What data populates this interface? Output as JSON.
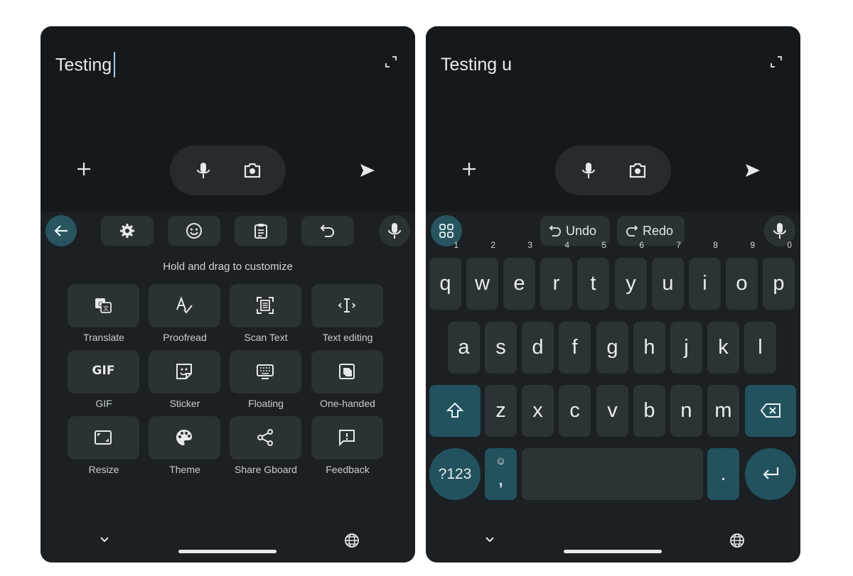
{
  "left": {
    "compose_text": "Testing",
    "hint": "Hold and drag to customize",
    "tiles": [
      {
        "label": "Translate",
        "icon": "translate-icon"
      },
      {
        "label": "Proofread",
        "icon": "proofread-icon"
      },
      {
        "label": "Scan Text",
        "icon": "scan-text-icon"
      },
      {
        "label": "Text editing",
        "icon": "text-editing-icon"
      },
      {
        "label": "GIF",
        "icon": "gif-icon"
      },
      {
        "label": "Sticker",
        "icon": "sticker-icon"
      },
      {
        "label": "Floating",
        "icon": "floating-icon"
      },
      {
        "label": "One-handed",
        "icon": "one-handed-icon"
      },
      {
        "label": "Resize",
        "icon": "resize-icon"
      },
      {
        "label": "Theme",
        "icon": "theme-icon"
      },
      {
        "label": "Share Gboard",
        "icon": "share-icon"
      },
      {
        "label": "Feedback",
        "icon": "feedback-icon"
      }
    ],
    "gif_glyph": "GIF"
  },
  "right": {
    "compose_text": "Testing u",
    "undo_label": "Undo",
    "redo_label": "Redo",
    "row1": [
      {
        "key": "q",
        "num": "1"
      },
      {
        "key": "w",
        "num": "2"
      },
      {
        "key": "e",
        "num": "3"
      },
      {
        "key": "r",
        "num": "4"
      },
      {
        "key": "t",
        "num": "5"
      },
      {
        "key": "y",
        "num": "6"
      },
      {
        "key": "u",
        "num": "7"
      },
      {
        "key": "i",
        "num": "8"
      },
      {
        "key": "o",
        "num": "9"
      },
      {
        "key": "p",
        "num": "0"
      }
    ],
    "row2": [
      "a",
      "s",
      "d",
      "f",
      "g",
      "h",
      "j",
      "k",
      "l"
    ],
    "row3": [
      "z",
      "x",
      "c",
      "v",
      "b",
      "n",
      "m"
    ],
    "symbols_key": "?123",
    "comma_key": ",",
    "comma_emoji": "☺",
    "period_key": "."
  },
  "colors": {
    "background": "#15191c",
    "keyboard": "#1a2023",
    "key": "#2c3337",
    "accent": "#22525e",
    "cursor": "#9fc7ff"
  }
}
